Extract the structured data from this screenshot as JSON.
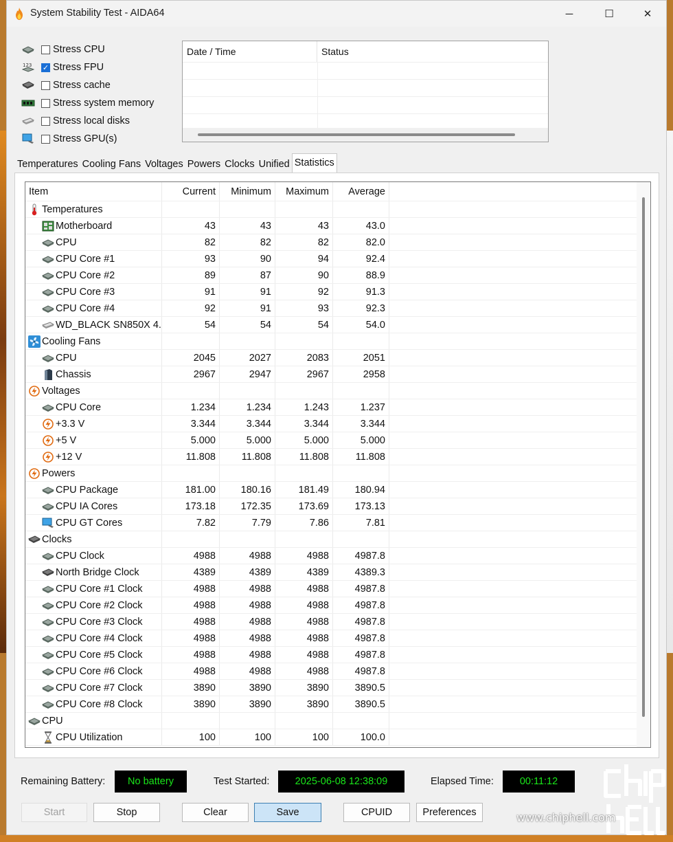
{
  "window": {
    "title": "System Stability Test - AIDA64",
    "min_glyph": "─",
    "max_glyph": "☐",
    "close_glyph": "✕"
  },
  "stress_options": [
    {
      "label": "Stress CPU",
      "checked": false,
      "icon": "cpu-chip-icon"
    },
    {
      "label": "Stress FPU",
      "checked": true,
      "icon": "fpu-digits-icon"
    },
    {
      "label": "Stress cache",
      "checked": false,
      "icon": "cache-chip-icon"
    },
    {
      "label": "Stress system memory",
      "checked": false,
      "icon": "memory-module-icon"
    },
    {
      "label": "Stress local disks",
      "checked": false,
      "icon": "disk-drive-icon"
    },
    {
      "label": "Stress GPU(s)",
      "checked": false,
      "icon": "monitor-icon"
    }
  ],
  "log": {
    "col_datetime": "Date / Time",
    "col_status": "Status"
  },
  "tabs": [
    "Temperatures",
    "Cooling Fans",
    "Voltages",
    "Powers",
    "Clocks",
    "Unified",
    "Statistics"
  ],
  "active_tab": "Statistics",
  "grid": {
    "headers": {
      "item": "Item",
      "current": "Current",
      "minimum": "Minimum",
      "maximum": "Maximum",
      "average": "Average"
    },
    "rows": [
      {
        "type": "group",
        "icon": "thermometer-icon",
        "item": "Temperatures"
      },
      {
        "type": "item",
        "icon": "motherboard-icon",
        "item": "Motherboard",
        "current": "43",
        "minimum": "43",
        "maximum": "43",
        "average": "43.0"
      },
      {
        "type": "item",
        "icon": "cpu-chip-icon",
        "item": "CPU",
        "current": "82",
        "minimum": "82",
        "maximum": "82",
        "average": "82.0"
      },
      {
        "type": "item",
        "icon": "cpu-chip-icon",
        "item": "CPU Core #1",
        "current": "93",
        "minimum": "90",
        "maximum": "94",
        "average": "92.4"
      },
      {
        "type": "item",
        "icon": "cpu-chip-icon",
        "item": "CPU Core #2",
        "current": "89",
        "minimum": "87",
        "maximum": "90",
        "average": "88.9"
      },
      {
        "type": "item",
        "icon": "cpu-chip-icon",
        "item": "CPU Core #3",
        "current": "91",
        "minimum": "91",
        "maximum": "92",
        "average": "91.3"
      },
      {
        "type": "item",
        "icon": "cpu-chip-icon",
        "item": "CPU Core #4",
        "current": "92",
        "minimum": "91",
        "maximum": "93",
        "average": "92.3"
      },
      {
        "type": "item",
        "icon": "disk-drive-icon",
        "item": "WD_BLACK SN850X 4...",
        "current": "54",
        "minimum": "54",
        "maximum": "54",
        "average": "54.0"
      },
      {
        "type": "group",
        "icon": "fan-icon",
        "item": "Cooling Fans"
      },
      {
        "type": "item",
        "icon": "cpu-chip-icon",
        "item": "CPU",
        "current": "2045",
        "minimum": "2027",
        "maximum": "2083",
        "average": "2051"
      },
      {
        "type": "item",
        "icon": "chassis-icon",
        "item": "Chassis",
        "current": "2967",
        "minimum": "2947",
        "maximum": "2967",
        "average": "2958"
      },
      {
        "type": "group",
        "icon": "voltage-icon",
        "item": "Voltages"
      },
      {
        "type": "item",
        "icon": "cpu-chip-icon",
        "item": "CPU Core",
        "current": "1.234",
        "minimum": "1.234",
        "maximum": "1.243",
        "average": "1.237"
      },
      {
        "type": "item",
        "icon": "voltage-icon",
        "item": "+3.3 V",
        "current": "3.344",
        "minimum": "3.344",
        "maximum": "3.344",
        "average": "3.344"
      },
      {
        "type": "item",
        "icon": "voltage-icon",
        "item": "+5 V",
        "current": "5.000",
        "minimum": "5.000",
        "maximum": "5.000",
        "average": "5.000"
      },
      {
        "type": "item",
        "icon": "voltage-icon",
        "item": "+12 V",
        "current": "11.808",
        "minimum": "11.808",
        "maximum": "11.808",
        "average": "11.808"
      },
      {
        "type": "group",
        "icon": "voltage-icon",
        "item": "Powers"
      },
      {
        "type": "item",
        "icon": "cpu-chip-icon",
        "item": "CPU Package",
        "current": "181.00",
        "minimum": "180.16",
        "maximum": "181.49",
        "average": "180.94"
      },
      {
        "type": "item",
        "icon": "cpu-chip-icon",
        "item": "CPU IA Cores",
        "current": "173.18",
        "minimum": "172.35",
        "maximum": "173.69",
        "average": "173.13"
      },
      {
        "type": "item",
        "icon": "monitor-icon",
        "item": "CPU GT Cores",
        "current": "7.82",
        "minimum": "7.79",
        "maximum": "7.86",
        "average": "7.81"
      },
      {
        "type": "group",
        "icon": "cache-chip-icon",
        "item": "Clocks"
      },
      {
        "type": "item",
        "icon": "cpu-chip-icon",
        "item": "CPU Clock",
        "current": "4988",
        "minimum": "4988",
        "maximum": "4988",
        "average": "4987.8"
      },
      {
        "type": "item",
        "icon": "cache-chip-icon",
        "item": "North Bridge Clock",
        "current": "4389",
        "minimum": "4389",
        "maximum": "4389",
        "average": "4389.3"
      },
      {
        "type": "item",
        "icon": "cpu-chip-icon",
        "item": "CPU Core #1 Clock",
        "current": "4988",
        "minimum": "4988",
        "maximum": "4988",
        "average": "4987.8"
      },
      {
        "type": "item",
        "icon": "cpu-chip-icon",
        "item": "CPU Core #2 Clock",
        "current": "4988",
        "minimum": "4988",
        "maximum": "4988",
        "average": "4987.8"
      },
      {
        "type": "item",
        "icon": "cpu-chip-icon",
        "item": "CPU Core #3 Clock",
        "current": "4988",
        "minimum": "4988",
        "maximum": "4988",
        "average": "4987.8"
      },
      {
        "type": "item",
        "icon": "cpu-chip-icon",
        "item": "CPU Core #4 Clock",
        "current": "4988",
        "minimum": "4988",
        "maximum": "4988",
        "average": "4987.8"
      },
      {
        "type": "item",
        "icon": "cpu-chip-icon",
        "item": "CPU Core #5 Clock",
        "current": "4988",
        "minimum": "4988",
        "maximum": "4988",
        "average": "4987.8"
      },
      {
        "type": "item",
        "icon": "cpu-chip-icon",
        "item": "CPU Core #6 Clock",
        "current": "4988",
        "minimum": "4988",
        "maximum": "4988",
        "average": "4987.8"
      },
      {
        "type": "item",
        "icon": "cpu-chip-icon",
        "item": "CPU Core #7 Clock",
        "current": "3890",
        "minimum": "3890",
        "maximum": "3890",
        "average": "3890.5"
      },
      {
        "type": "item",
        "icon": "cpu-chip-icon",
        "item": "CPU Core #8 Clock",
        "current": "3890",
        "minimum": "3890",
        "maximum": "3890",
        "average": "3890.5"
      },
      {
        "type": "group",
        "icon": "cpu-chip-icon",
        "item": "CPU"
      },
      {
        "type": "item",
        "icon": "hourglass-icon",
        "item": "CPU Utilization",
        "current": "100",
        "minimum": "100",
        "maximum": "100",
        "average": "100.0"
      }
    ]
  },
  "status": {
    "battery_label": "Remaining Battery:",
    "battery_value": "No battery",
    "started_label": "Test Started:",
    "started_value": "2025-06-08 12:38:09",
    "elapsed_label": "Elapsed Time:",
    "elapsed_value": "00:11:12"
  },
  "buttons": {
    "start": "Start",
    "stop": "Stop",
    "clear": "Clear",
    "save": "Save",
    "cpuid": "CPUID",
    "preferences": "Preferences"
  },
  "watermark": {
    "text": "www.chiphell.com"
  },
  "colors": {
    "lcd_text": "#19e619",
    "lcd_bg": "#000000",
    "accent": "#1a6fd6"
  }
}
